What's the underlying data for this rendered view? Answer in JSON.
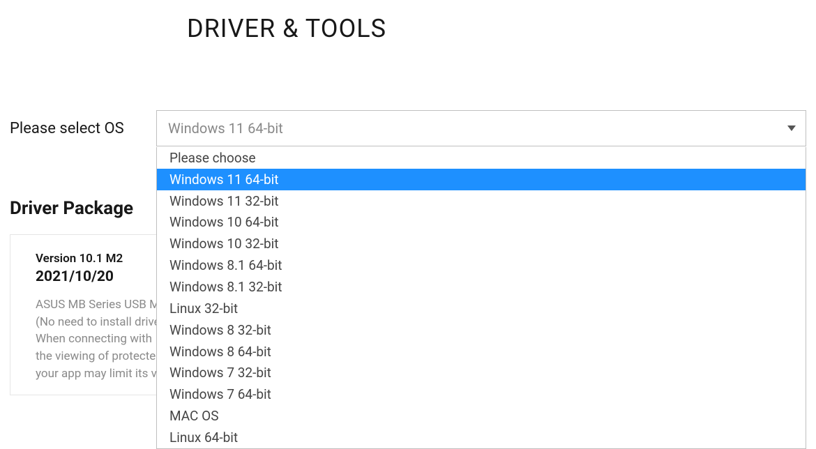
{
  "pageTitle": "DRIVER & TOOLS",
  "osSelect": {
    "label": "Please select OS",
    "selected": "Windows 11 64-bit",
    "options": [
      "Please choose",
      "Windows 11 64-bit",
      "Windows 11 32-bit",
      "Windows 10 64-bit",
      "Windows 10 32-bit",
      "Windows 8.1 64-bit",
      "Windows 8.1 32-bit",
      "Linux 32-bit",
      "Windows 8 32-bit",
      "Windows 8 64-bit",
      "Windows 7 32-bit",
      "Windows 7 64-bit",
      "MAC OS",
      "Linux 64-bit"
    ],
    "highlightedIndex": 1
  },
  "section": {
    "title": "Driver Package"
  },
  "card": {
    "version": "Version 10.1 M2",
    "date": "2021/10/20",
    "descLines": [
      "ASUS MB Series USB M",
      "(No need to install drive",
      "When connecting with",
      "the viewing of protecte",
      "your app may limit its v"
    ]
  }
}
